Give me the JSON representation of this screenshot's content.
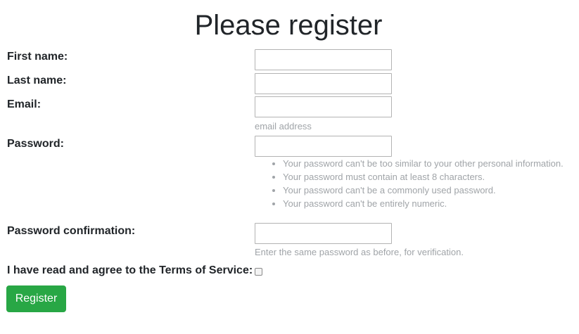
{
  "page": {
    "title": "Please register"
  },
  "form": {
    "first_name": {
      "label": "First name:",
      "value": ""
    },
    "last_name": {
      "label": "Last name:",
      "value": ""
    },
    "email": {
      "label": "Email:",
      "value": "",
      "help": "email address"
    },
    "password": {
      "label": "Password:",
      "value": "",
      "help_items": [
        "Your password can't be too similar to your other personal information.",
        "Your password must contain at least 8 characters.",
        "Your password can't be a commonly used password.",
        "Your password can't be entirely numeric."
      ]
    },
    "password_confirmation": {
      "label": "Password confirmation:",
      "value": "",
      "help": "Enter the same password as before, for verification."
    },
    "terms": {
      "label": "I have read and agree to the Terms of Service:",
      "checked": false
    },
    "submit_label": "Register"
  },
  "colors": {
    "submit_button": "#28a745",
    "help_text": "#a0a4a8",
    "text": "#212529"
  }
}
